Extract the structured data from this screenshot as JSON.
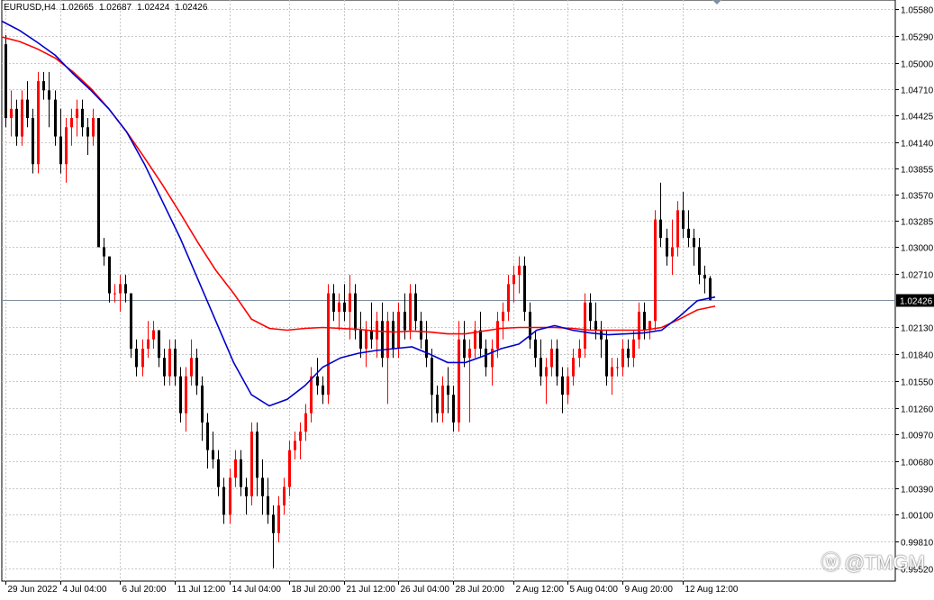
{
  "header": {
    "symbol": "EURUSD,H4",
    "open": "1.02665",
    "high": "1.02687",
    "low": "1.02424",
    "close": "1.02426"
  },
  "watermark": {
    "text": "@TMGM",
    "icon": "weibo-logo-icon"
  },
  "colors": {
    "bull": "#ff0000",
    "bear": "#000000",
    "ma_fast": "#0000cc",
    "ma_slow": "#ff0000",
    "grid": "#c8c8c8",
    "price_line": "#7f8fa0",
    "price_label_bg": "#000000"
  },
  "chart_data": {
    "type": "candlestick",
    "symbol": "EURUSD",
    "timeframe": "H4",
    "grid": true,
    "ylim": [
      0.9938,
      1.0568
    ],
    "yticks": [
      "1.05580",
      "1.05290",
      "1.05000",
      "1.04710",
      "1.04425",
      "1.04140",
      "1.03855",
      "1.03570",
      "1.03285",
      "1.03000",
      "1.02710",
      "1.02130",
      "1.01840",
      "1.01550",
      "1.01260",
      "1.00970",
      "1.00680",
      "1.00390",
      "1.00100",
      "0.99810",
      "0.99520"
    ],
    "xticks": [
      "29 Jun 2022",
      "4 Jul 04:00",
      "6 Jul 20:00",
      "11 Jul 12:00",
      "14 Jul 04:00",
      "18 Jul 20:00",
      "21 Jul 12:00",
      "26 Jul 04:00",
      "28 Jul 20:00",
      "2 Aug 12:00",
      "5 Aug 04:00",
      "9 Aug 20:00",
      "12 Aug 12:00"
    ],
    "current_price": "1.02426",
    "ohlc": [
      [
        1.052,
        1.053,
        1.043,
        1.044
      ],
      [
        1.044,
        1.047,
        1.042,
        1.045
      ],
      [
        1.045,
        1.046,
        1.041,
        1.042
      ],
      [
        1.042,
        1.047,
        1.041,
        1.046
      ],
      [
        1.046,
        1.048,
        1.043,
        1.044
      ],
      [
        1.044,
        1.045,
        1.038,
        1.039
      ],
      [
        1.039,
        1.049,
        1.038,
        1.048
      ],
      [
        1.048,
        1.049,
        1.046,
        1.047
      ],
      [
        1.047,
        1.049,
        1.043,
        1.046
      ],
      [
        1.046,
        1.047,
        1.041,
        1.042
      ],
      [
        1.042,
        1.045,
        1.038,
        1.039
      ],
      [
        1.039,
        1.044,
        1.037,
        1.043
      ],
      [
        1.043,
        1.045,
        1.041,
        1.044
      ],
      [
        1.044,
        1.046,
        1.042,
        1.045
      ],
      [
        1.045,
        1.046,
        1.042,
        1.043
      ],
      [
        1.043,
        1.044,
        1.04,
        1.042
      ],
      [
        1.042,
        1.045,
        1.041,
        1.044
      ],
      [
        1.044,
        1.044,
        1.03,
        1.03
      ],
      [
        1.03,
        1.031,
        1.028,
        1.029
      ],
      [
        1.029,
        1.029,
        1.024,
        1.025
      ],
      [
        1.025,
        1.026,
        1.024,
        1.025
      ],
      [
        1.025,
        1.027,
        1.023,
        1.026
      ],
      [
        1.026,
        1.027,
        1.024,
        1.025
      ],
      [
        1.025,
        1.025,
        1.018,
        1.019
      ],
      [
        1.019,
        1.02,
        1.016,
        1.017
      ],
      [
        1.017,
        1.02,
        1.016,
        1.019
      ],
      [
        1.019,
        1.022,
        1.018,
        1.02
      ],
      [
        1.02,
        1.022,
        1.019,
        1.021
      ],
      [
        1.021,
        1.021,
        1.017,
        1.018
      ],
      [
        1.018,
        1.019,
        1.015,
        1.016
      ],
      [
        1.016,
        1.02,
        1.015,
        1.019
      ],
      [
        1.019,
        1.02,
        1.015,
        1.016
      ],
      [
        1.016,
        1.017,
        1.011,
        1.012
      ],
      [
        1.012,
        1.017,
        1.01,
        1.016
      ],
      [
        1.016,
        1.02,
        1.015,
        1.018
      ],
      [
        1.018,
        1.019,
        1.014,
        1.015
      ],
      [
        1.015,
        1.016,
        1.009,
        1.011
      ],
      [
        1.011,
        1.012,
        1.006,
        1.008
      ],
      [
        1.008,
        1.01,
        1.006,
        1.007
      ],
      [
        1.007,
        1.008,
        1.003,
        1.004
      ],
      [
        1.004,
        1.005,
        1.0,
        1.001
      ],
      [
        1.001,
        1.006,
        1.0,
        1.005
      ],
      [
        1.005,
        1.008,
        1.004,
        1.007
      ],
      [
        1.007,
        1.008,
        1.003,
        1.004
      ],
      [
        1.004,
        1.005,
        1.001,
        1.003
      ],
      [
        1.003,
        1.011,
        1.002,
        1.01
      ],
      [
        1.01,
        1.011,
        1.003,
        1.005
      ],
      [
        1.005,
        1.007,
        1.001,
        1.003
      ],
      [
        1.003,
        1.005,
        1.0,
        1.001
      ],
      [
        1.001,
        1.002,
        0.9952,
        0.999
      ],
      [
        0.999,
        1.003,
        0.998,
        1.002
      ],
      [
        1.002,
        1.005,
        1.001,
        1.004
      ],
      [
        1.004,
        1.009,
        1.003,
        1.008
      ],
      [
        1.008,
        1.01,
        1.007,
        1.009
      ],
      [
        1.009,
        1.011,
        1.007,
        1.01
      ],
      [
        1.01,
        1.013,
        1.009,
        1.012
      ],
      [
        1.012,
        1.017,
        1.011,
        1.016
      ],
      [
        1.016,
        1.018,
        1.014,
        1.015
      ],
      [
        1.015,
        1.016,
        1.013,
        1.014
      ],
      [
        1.014,
        1.026,
        1.013,
        1.025
      ],
      [
        1.025,
        1.026,
        1.022,
        1.023
      ],
      [
        1.023,
        1.025,
        1.021,
        1.024
      ],
      [
        1.024,
        1.026,
        1.022,
        1.023
      ],
      [
        1.023,
        1.027,
        1.02,
        1.025
      ],
      [
        1.025,
        1.026,
        1.02,
        1.021
      ],
      [
        1.021,
        1.023,
        1.018,
        1.019
      ],
      [
        1.019,
        1.022,
        1.017,
        1.021
      ],
      [
        1.021,
        1.024,
        1.019,
        1.02
      ],
      [
        1.02,
        1.023,
        1.018,
        1.022
      ],
      [
        1.022,
        1.024,
        1.017,
        1.018
      ],
      [
        1.018,
        1.023,
        1.013,
        1.022
      ],
      [
        1.022,
        1.023,
        1.018,
        1.019
      ],
      [
        1.019,
        1.024,
        1.018,
        1.023
      ],
      [
        1.023,
        1.025,
        1.02,
        1.021
      ],
      [
        1.021,
        1.026,
        1.02,
        1.025
      ],
      [
        1.025,
        1.026,
        1.021,
        1.022
      ],
      [
        1.022,
        1.023,
        1.019,
        1.02
      ],
      [
        1.02,
        1.022,
        1.017,
        1.018
      ],
      [
        1.018,
        1.019,
        1.011,
        1.014
      ],
      [
        1.014,
        1.015,
        1.011,
        1.012
      ],
      [
        1.012,
        1.016,
        1.011,
        1.015
      ],
      [
        1.015,
        1.017,
        1.012,
        1.014
      ],
      [
        1.014,
        1.015,
        1.01,
        1.011
      ],
      [
        1.011,
        1.022,
        1.01,
        1.02
      ],
      [
        1.02,
        1.022,
        1.017,
        1.018
      ],
      [
        1.018,
        1.02,
        1.011,
        1.019
      ],
      [
        1.019,
        1.022,
        1.018,
        1.021
      ],
      [
        1.021,
        1.023,
        1.018,
        1.019
      ],
      [
        1.019,
        1.02,
        1.016,
        1.017
      ],
      [
        1.017,
        1.02,
        1.015,
        1.019
      ],
      [
        1.019,
        1.023,
        1.018,
        1.022
      ],
      [
        1.022,
        1.024,
        1.02,
        1.023
      ],
      [
        1.023,
        1.027,
        1.022,
        1.026
      ],
      [
        1.026,
        1.028,
        1.024,
        1.027
      ],
      [
        1.027,
        1.029,
        1.025,
        1.028
      ],
      [
        1.028,
        1.029,
        1.022,
        1.023
      ],
      [
        1.023,
        1.024,
        1.019,
        1.02
      ],
      [
        1.02,
        1.021,
        1.017,
        1.018
      ],
      [
        1.018,
        1.02,
        1.015,
        1.016
      ],
      [
        1.016,
        1.018,
        1.013,
        1.017
      ],
      [
        1.017,
        1.02,
        1.016,
        1.019
      ],
      [
        1.019,
        1.02,
        1.015,
        1.016
      ],
      [
        1.016,
        1.017,
        1.012,
        1.014
      ],
      [
        1.014,
        1.017,
        1.013,
        1.016
      ],
      [
        1.016,
        1.019,
        1.015,
        1.018
      ],
      [
        1.018,
        1.02,
        1.017,
        1.019
      ],
      [
        1.019,
        1.025,
        1.018,
        1.024
      ],
      [
        1.024,
        1.025,
        1.021,
        1.022
      ],
      [
        1.022,
        1.024,
        1.02,
        1.021
      ],
      [
        1.021,
        1.022,
        1.018,
        1.02
      ],
      [
        1.02,
        1.021,
        1.015,
        1.016
      ],
      [
        1.016,
        1.018,
        1.014,
        1.017
      ],
      [
        1.017,
        1.018,
        1.016,
        1.017
      ],
      [
        1.017,
        1.02,
        1.016,
        1.019
      ],
      [
        1.019,
        1.02,
        1.017,
        1.018
      ],
      [
        1.018,
        1.021,
        1.017,
        1.02
      ],
      [
        1.02,
        1.024,
        1.019,
        1.023
      ],
      [
        1.023,
        1.024,
        1.02,
        1.021
      ],
      [
        1.021,
        1.022,
        1.02,
        1.022
      ],
      [
        1.022,
        1.034,
        1.021,
        1.033
      ],
      [
        1.033,
        1.037,
        1.03,
        1.031
      ],
      [
        1.031,
        1.032,
        1.028,
        1.029
      ],
      [
        1.029,
        1.033,
        1.027,
        1.03
      ],
      [
        1.03,
        1.035,
        1.029,
        1.034
      ],
      [
        1.034,
        1.036,
        1.031,
        1.032
      ],
      [
        1.032,
        1.034,
        1.03,
        1.031
      ],
      [
        1.031,
        1.032,
        1.028,
        1.03
      ],
      [
        1.03,
        1.031,
        1.026,
        1.027
      ],
      [
        1.027,
        1.028,
        1.025,
        1.0266
      ],
      [
        1.02665,
        1.02687,
        1.02424,
        1.02426
      ]
    ],
    "ma_fast": [
      1.0545,
      1.0535,
      1.0522,
      1.0508,
      1.0488,
      1.047,
      1.045,
      1.0425,
      1.039,
      1.035,
      1.031,
      1.0265,
      1.022,
      1.0175,
      1.014,
      1.0128,
      1.0135,
      1.015,
      1.017,
      1.018,
      1.0185,
      1.0188,
      1.019,
      1.0192,
      1.0184,
      1.0175,
      1.0175,
      1.0182,
      1.019,
      1.0195,
      1.021,
      1.0215,
      1.021,
      1.0207,
      1.0205,
      1.0206,
      1.0207,
      1.021,
      1.0225,
      1.0242,
      1.0246
    ],
    "ma_slow": [
      1.0528,
      1.0523,
      1.0515,
      1.0505,
      1.049,
      1.0472,
      1.045,
      1.0425,
      1.0397,
      1.0368,
      1.0337,
      1.0305,
      1.0275,
      1.025,
      1.0222,
      1.0212,
      1.021,
      1.0212,
      1.0213,
      1.0212,
      1.0211,
      1.0209,
      1.0208,
      1.0209,
      1.0208,
      1.0206,
      1.0206,
      1.0209,
      1.0212,
      1.0213,
      1.0213,
      1.0213,
      1.0212,
      1.021,
      1.021,
      1.021,
      1.021,
      1.0213,
      1.0222,
      1.0232,
      1.0236
    ]
  }
}
